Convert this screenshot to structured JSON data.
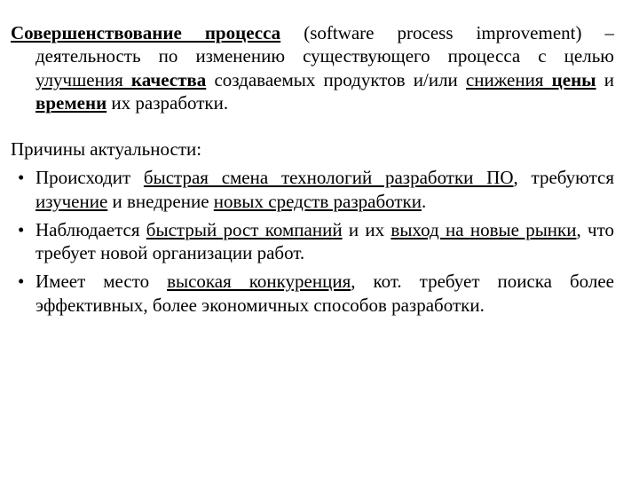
{
  "definition": {
    "term": "Совершенствование процесса",
    "paren": "(software process improvement)",
    "mid1": " – деятельность по изменению существующего процесса с целью ",
    "qual_improve": "улучшения ",
    "quality": "качества",
    "mid2": " создаваемых продуктов и/или ",
    "price_reduce": "снижения ",
    "price": "цены",
    "and": " и ",
    "time": "времени",
    "tail": " их разработки."
  },
  "subhead": "Причины актуальности:",
  "bullets": [
    {
      "p1": "Происходит ",
      "u1": "быстрая смена технологий разработки ПО",
      "p2": ", требуются ",
      "u2": "изучение",
      "p3": " и внедрение ",
      "u3": "новых средств разработки",
      "p4": "."
    },
    {
      "p1": "Наблюдается ",
      "u1": "быстрый рост компаний",
      "p2": " и их ",
      "u2": "выход на новые рынки",
      "p3": ", что требует новой организации работ.",
      "u3": "",
      "p4": ""
    },
    {
      "p1": "Имеет место ",
      "u1": "высокая конкуренция",
      "p2": ", кот. требует поиска более эффективных, более экономичных способов разработки.",
      "u2": "",
      "p3": "",
      "u3": "",
      "p4": ""
    }
  ]
}
